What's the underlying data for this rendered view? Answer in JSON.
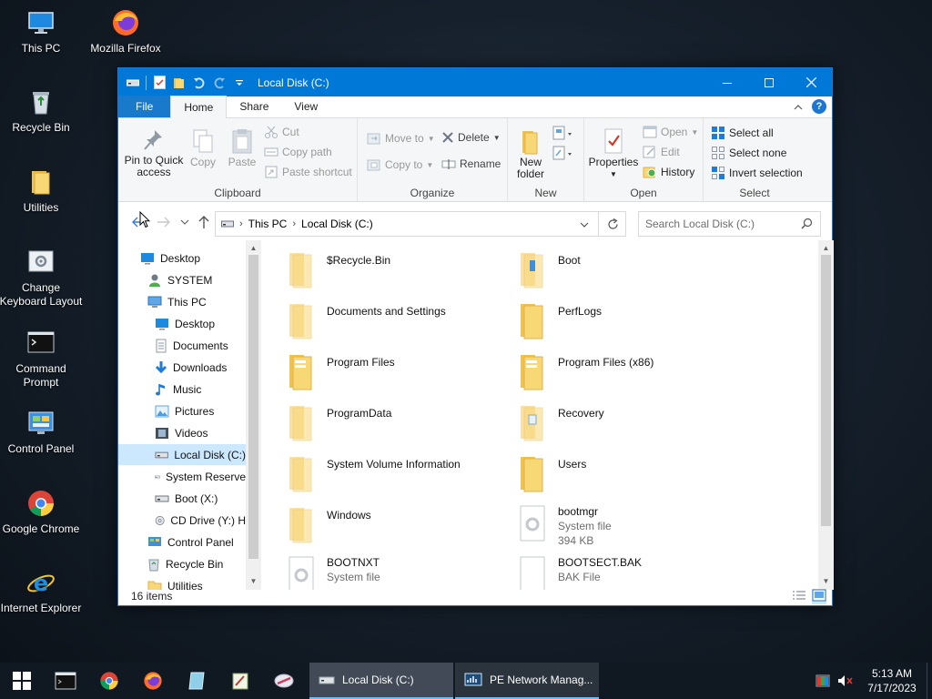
{
  "desktop": {
    "icons": [
      {
        "label": "This PC"
      },
      {
        "label": "Mozilla Firefox"
      },
      {
        "label": "Recycle Bin"
      },
      {
        "label": "Utilities"
      },
      {
        "label": "Change Keyboard Layout"
      },
      {
        "label": "Command Prompt"
      },
      {
        "label": "Control Panel"
      },
      {
        "label": "Google Chrome"
      },
      {
        "label": "Internet Explorer"
      }
    ]
  },
  "window": {
    "title": "Local Disk (C:)",
    "tabs": {
      "file": "File",
      "home": "Home",
      "share": "Share",
      "view": "View"
    },
    "help": "?",
    "ribbon": {
      "clipboard": {
        "label": "Clipboard",
        "pin": "Pin to Quick access",
        "copy": "Copy",
        "paste": "Paste",
        "cut": "Cut",
        "copy_path": "Copy path",
        "paste_shortcut": "Paste shortcut"
      },
      "organize": {
        "label": "Organize",
        "move_to": "Move to",
        "copy_to": "Copy to",
        "delete": "Delete",
        "rename": "Rename"
      },
      "new": {
        "label": "New",
        "new_folder": "New folder"
      },
      "open": {
        "label": "Open",
        "properties": "Properties",
        "open": "Open",
        "edit": "Edit",
        "history": "History"
      },
      "select": {
        "label": "Select",
        "select_all": "Select all",
        "select_none": "Select none",
        "invert": "Invert selection"
      }
    },
    "address": {
      "crumbs": [
        "This PC",
        "Local Disk (C:)"
      ],
      "search_placeholder": "Search Local Disk (C:)"
    },
    "nav": [
      {
        "label": "Desktop"
      },
      {
        "label": "SYSTEM"
      },
      {
        "label": "This PC"
      },
      {
        "label": "Desktop"
      },
      {
        "label": "Documents"
      },
      {
        "label": "Downloads"
      },
      {
        "label": "Music"
      },
      {
        "label": "Pictures"
      },
      {
        "label": "Videos"
      },
      {
        "label": "Local Disk (C:)"
      },
      {
        "label": "System Reserve"
      },
      {
        "label": "Boot (X:)"
      },
      {
        "label": "CD Drive (Y:) H"
      },
      {
        "label": "Control Panel"
      },
      {
        "label": "Recycle Bin"
      },
      {
        "label": "Utilities"
      }
    ],
    "files": [
      {
        "name": "$Recycle.Bin",
        "type": "",
        "size": ""
      },
      {
        "name": "Boot",
        "type": "",
        "size": ""
      },
      {
        "name": "Documents and Settings",
        "type": "",
        "size": ""
      },
      {
        "name": "PerfLogs",
        "type": "",
        "size": ""
      },
      {
        "name": "Program Files",
        "type": "",
        "size": ""
      },
      {
        "name": "Program Files (x86)",
        "type": "",
        "size": ""
      },
      {
        "name": "ProgramData",
        "type": "",
        "size": ""
      },
      {
        "name": "Recovery",
        "type": "",
        "size": ""
      },
      {
        "name": "System Volume Information",
        "type": "",
        "size": ""
      },
      {
        "name": "Users",
        "type": "",
        "size": ""
      },
      {
        "name": "Windows",
        "type": "",
        "size": ""
      },
      {
        "name": "bootmgr",
        "type": "System file",
        "size": "394 KB"
      },
      {
        "name": "BOOTNXT",
        "type": "System file",
        "size": ""
      },
      {
        "name": "BOOTSECT.BAK",
        "type": "BAK File",
        "size": ""
      }
    ],
    "status": "16 items"
  },
  "taskbar": {
    "buttons": [
      {
        "label": "Local Disk (C:)"
      },
      {
        "label": "PE Network Manag..."
      }
    ],
    "time": "5:13 AM",
    "date": "7/17/2023"
  },
  "colors": {
    "accent": "#0078d7",
    "folder": "#f8d775",
    "selection": "#cce8ff"
  }
}
